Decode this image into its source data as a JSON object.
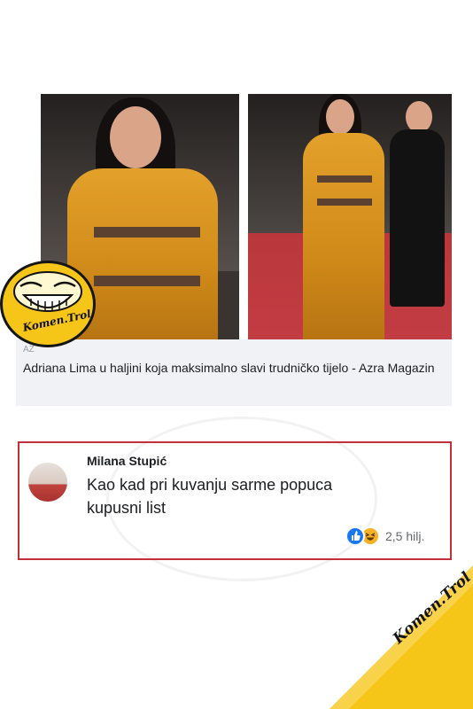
{
  "post": {
    "caption_source": "AZ",
    "caption_title": "Adriana Lima u haljini koja maksimalno slavi trudničko tijelo - Azra Magazin"
  },
  "branding": {
    "badge_text": "Komen.Trol",
    "corner_text": "Komen.Trol",
    "accent_color": "#f5c518"
  },
  "comment": {
    "author": "Milana Stupić",
    "text": "Kao kad pri kuvanju sarme popuca kupusni list",
    "reaction_count": "2,5 hilj.",
    "reactions": [
      "like-icon",
      "haha-icon"
    ],
    "highlight_color": "#c2303a"
  }
}
